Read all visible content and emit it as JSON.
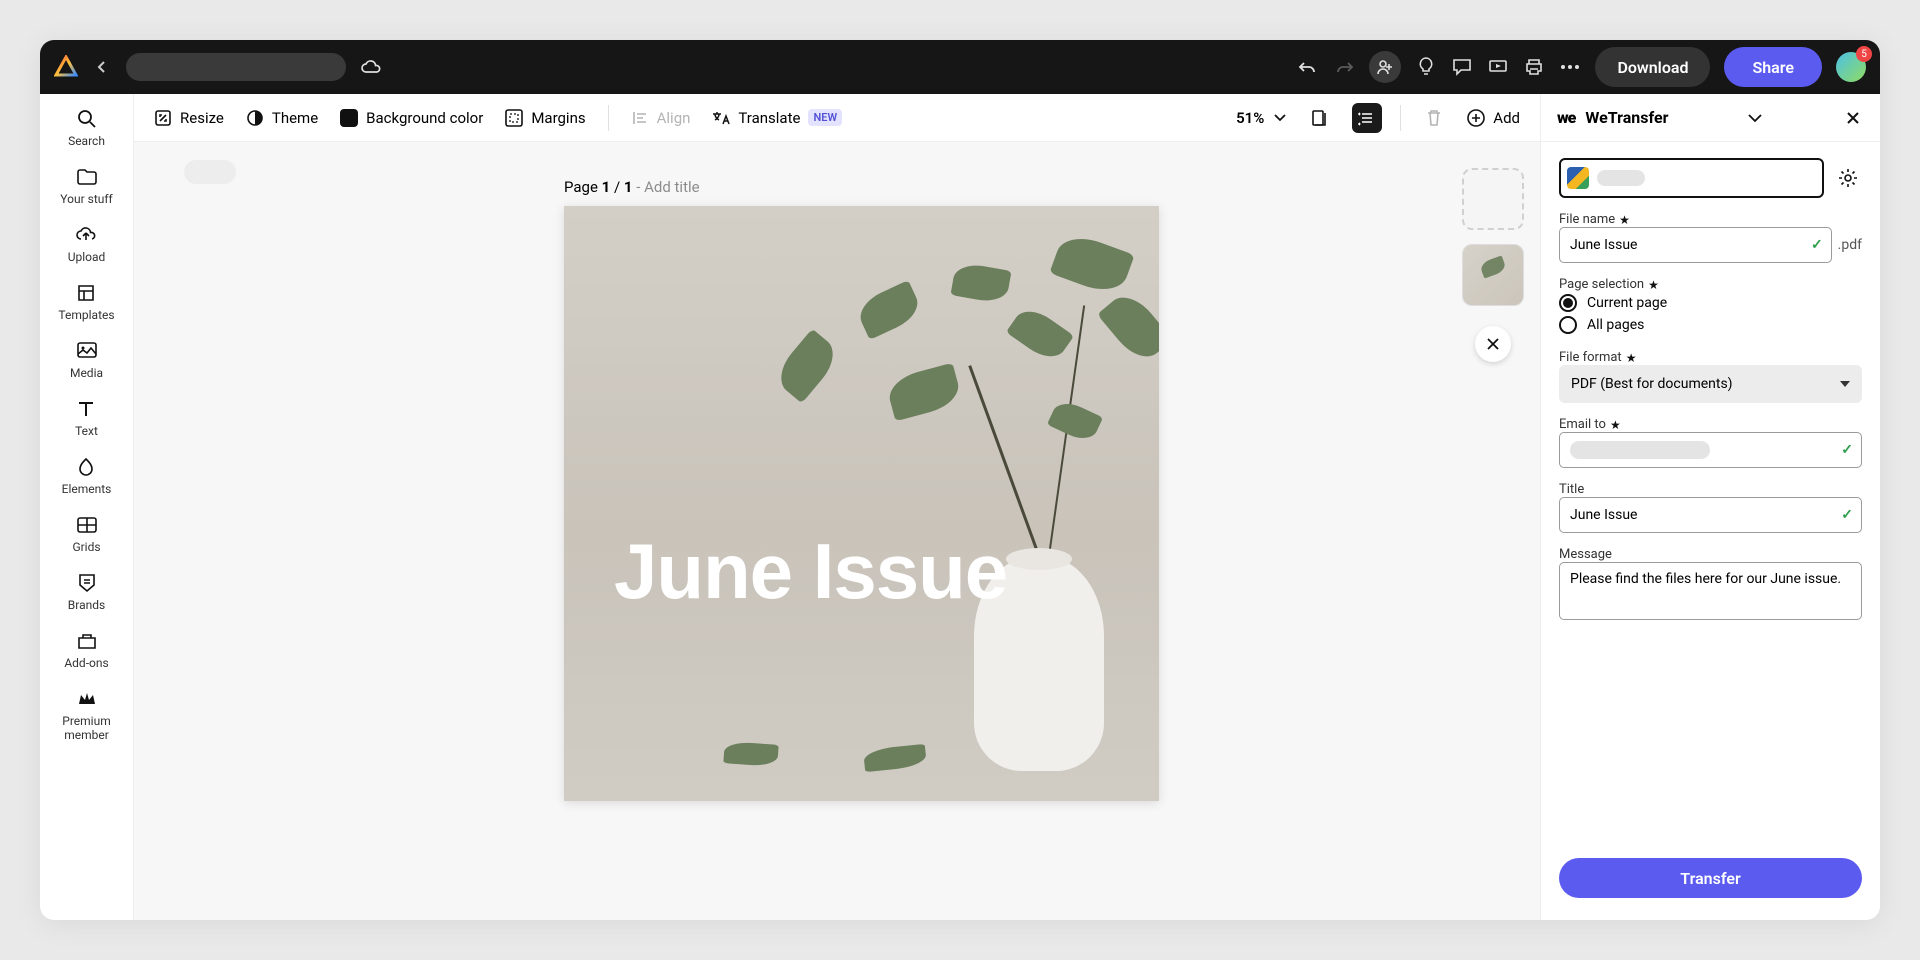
{
  "header": {
    "download_label": "Download",
    "share_label": "Share",
    "notification_count": "5"
  },
  "left_rail": {
    "items": [
      {
        "label": "Search"
      },
      {
        "label": "Your stuff"
      },
      {
        "label": "Upload"
      },
      {
        "label": "Templates"
      },
      {
        "label": "Media"
      },
      {
        "label": "Text"
      },
      {
        "label": "Elements"
      },
      {
        "label": "Grids"
      },
      {
        "label": "Brands"
      },
      {
        "label": "Add-ons"
      },
      {
        "label": "Premium member"
      }
    ]
  },
  "toolbar": {
    "resize": "Resize",
    "theme": "Theme",
    "bgcolor": "Background color",
    "margins": "Margins",
    "align": "Align",
    "translate": "Translate",
    "badge_new": "NEW",
    "zoom": "51%",
    "add": "Add"
  },
  "canvas": {
    "page_label_prefix": "Page ",
    "page_current": "1",
    "page_sep": " / ",
    "page_total": "1",
    "add_title_hint": " - Add title",
    "artwork_title": "June Issue"
  },
  "panel": {
    "title": "WeTransfer",
    "file_name_label": "File name",
    "file_name_value": "June Issue",
    "file_ext": ".pdf",
    "page_selection_label": "Page selection",
    "radio_current": "Current page",
    "radio_all": "All pages",
    "file_format_label": "File format",
    "file_format_value": "PDF (Best for documents)",
    "email_to_label": "Email to",
    "title_label": "Title",
    "title_value": "June Issue",
    "message_label": "Message",
    "message_value": "Please find the files here for our June issue.",
    "transfer_button": "Transfer"
  }
}
